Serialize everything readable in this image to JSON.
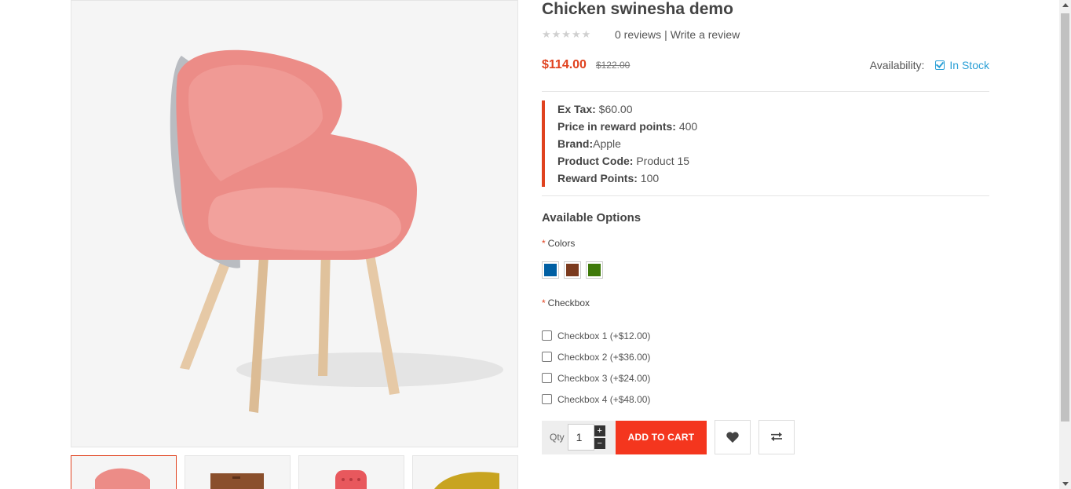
{
  "product": {
    "title": "Chicken swinesha demo",
    "reviews_link": "0 reviews",
    "separator": "|",
    "write_review": "Write a review",
    "price_new": "$114.00",
    "price_old": "$122.00",
    "availability_label": "Availability:",
    "availability_value": "In Stock"
  },
  "meta": [
    {
      "label": "Ex Tax:",
      "value": " $60.00"
    },
    {
      "label": "Price in reward points:",
      "value": " 400"
    },
    {
      "label": "Brand:",
      "value": "Apple"
    },
    {
      "label": "Product Code:",
      "value": " Product 15"
    },
    {
      "label": "Reward Points:",
      "value": " 100"
    }
  ],
  "options": {
    "title": "Available Options",
    "colors_label": "Colors",
    "colors": [
      "#005fa3",
      "#7b3a1e",
      "#3f7a0a"
    ],
    "checkbox_label": "Checkbox",
    "checkboxes": [
      "Checkbox 1 (+$12.00)",
      "Checkbox 2 (+$36.00)",
      "Checkbox 3 (+$24.00)",
      "Checkbox 4 (+$48.00)"
    ],
    "required_mark": "*"
  },
  "cart": {
    "qty_label": "Qty",
    "qty_value": "1",
    "plus": "+",
    "minus": "−",
    "add_to_cart": "ADD TO CART"
  },
  "icons": {
    "wishlist": "heart-icon",
    "compare": "exchange-icon",
    "stars": "★★★★★"
  }
}
